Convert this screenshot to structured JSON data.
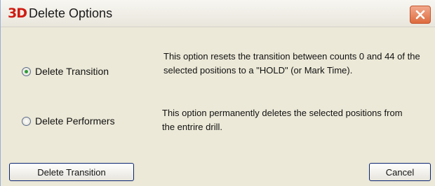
{
  "window": {
    "logo": "3D",
    "title": "Delete Options"
  },
  "options": [
    {
      "label": "Delete Transition",
      "selected": true,
      "description": "This option resets the transition between counts 0 and 44 of the selected positions to a \"HOLD\" (or Mark Time)."
    },
    {
      "label": "Delete Performers",
      "selected": false,
      "description": "This option permanently deletes the selected positions from the entrire drill."
    }
  ],
  "buttons": {
    "confirm_label": "Delete Transition",
    "cancel_label": "Cancel"
  },
  "icons": {
    "close": "close-icon",
    "logo": "app-logo-icon"
  },
  "colors": {
    "close_button": "#dd6b3e",
    "logo": "#cf1c12",
    "radio_selected": "#2f9a36"
  }
}
